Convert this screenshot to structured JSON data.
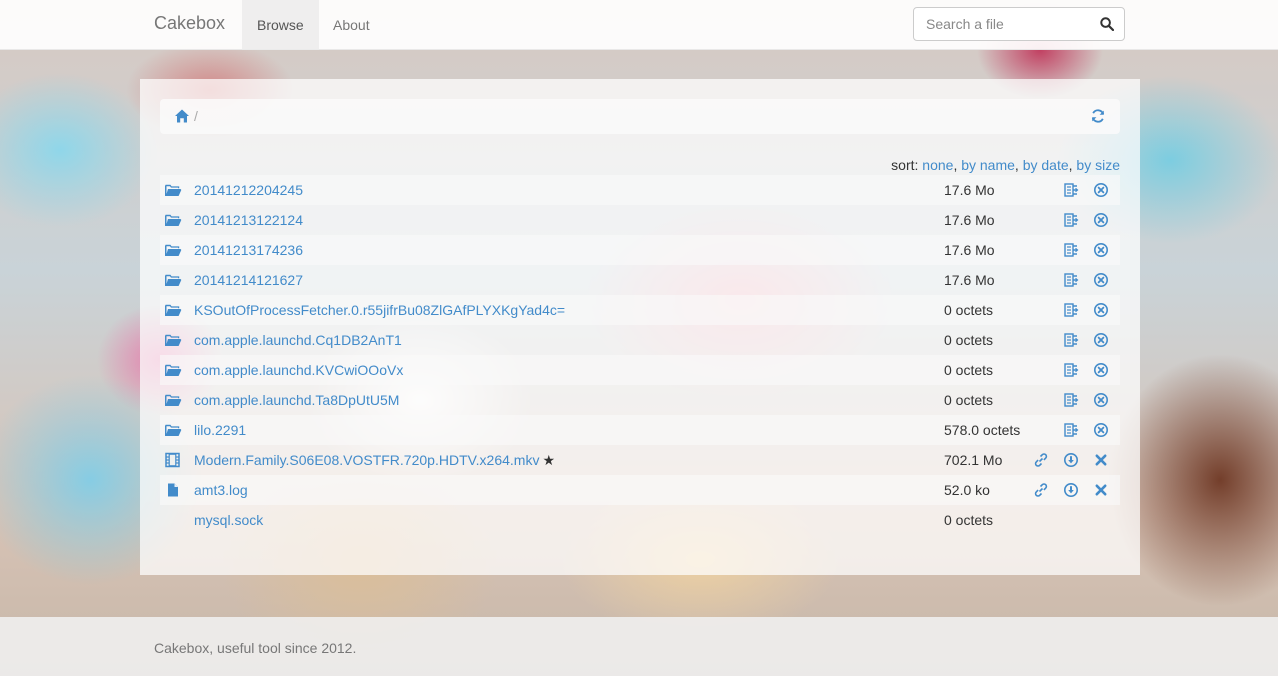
{
  "nav": {
    "brand": "Cakebox",
    "links": [
      {
        "label": "Browse",
        "active": true
      },
      {
        "label": "About",
        "active": false
      }
    ],
    "search_placeholder": "Search a file"
  },
  "breadcrumb": {
    "separator": "/"
  },
  "sort": {
    "prefix": "sort:",
    "options": [
      "none",
      "by name",
      "by date",
      "by size"
    ]
  },
  "entries": [
    {
      "type": "folder",
      "name": "20141212204245",
      "size": "17.6 Mo",
      "actions": [
        "archive",
        "delete"
      ]
    },
    {
      "type": "folder",
      "name": "20141213122124",
      "size": "17.6 Mo",
      "actions": [
        "archive",
        "delete"
      ]
    },
    {
      "type": "folder",
      "name": "20141213174236",
      "size": "17.6 Mo",
      "actions": [
        "archive",
        "delete"
      ]
    },
    {
      "type": "folder",
      "name": "20141214121627",
      "size": "17.6 Mo",
      "actions": [
        "archive",
        "delete"
      ]
    },
    {
      "type": "folder",
      "name": "KSOutOfProcessFetcher.0.r55jifrBu08ZlGAfPLYXKgYad4c=",
      "size": "0 octets",
      "actions": [
        "archive",
        "delete"
      ]
    },
    {
      "type": "folder",
      "name": "com.apple.launchd.Cq1DB2AnT1",
      "size": "0 octets",
      "actions": [
        "archive",
        "delete"
      ]
    },
    {
      "type": "folder",
      "name": "com.apple.launchd.KVCwiOOoVx",
      "size": "0 octets",
      "actions": [
        "archive",
        "delete"
      ]
    },
    {
      "type": "folder",
      "name": "com.apple.launchd.Ta8DpUtU5M",
      "size": "0 octets",
      "actions": [
        "archive",
        "delete"
      ]
    },
    {
      "type": "folder",
      "name": "lilo.2291",
      "size": "578.0 octets",
      "actions": [
        "archive",
        "delete"
      ]
    },
    {
      "type": "video",
      "name": "Modern.Family.S06E08.VOSTFR.720p.HDTV.x264.mkv",
      "star": "★",
      "size": "702.1 Mo",
      "actions": [
        "link",
        "download",
        "remove"
      ]
    },
    {
      "type": "file",
      "name": "amt3.log",
      "size": "52.0 ko",
      "actions": [
        "link",
        "download",
        "remove"
      ]
    },
    {
      "type": "none",
      "name": "mysql.sock",
      "size": "0 octets",
      "actions": []
    }
  ],
  "footer": {
    "text": "Cakebox, useful tool since 2012."
  },
  "colors": {
    "link": "#428bca",
    "muted": "#777777"
  }
}
